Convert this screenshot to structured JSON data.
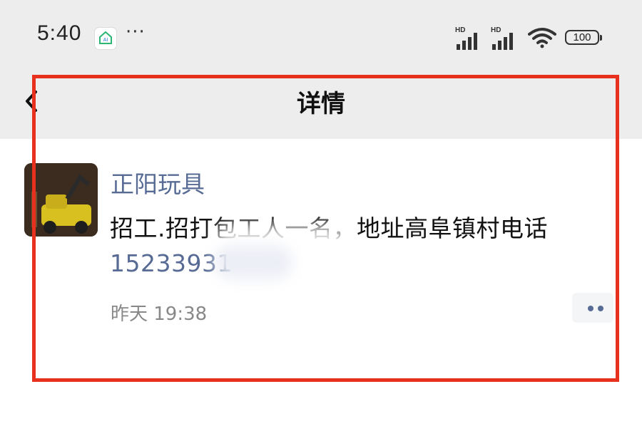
{
  "status_bar": {
    "time": "5:40",
    "overflow": "···",
    "signal_1_label": "HD",
    "signal_2_label": "HD",
    "battery": "100"
  },
  "nav": {
    "title": "详情",
    "back_icon": "chevron-left-icon"
  },
  "moment": {
    "sender": "正阳玩具",
    "text": "招工.招打包工人一名，地址高阜镇村电话",
    "phone": "15233931",
    "timestamp": "昨天 19:38",
    "more_icon": "more-dots-icon"
  },
  "colors": {
    "link": "#576b95",
    "header_bg": "#ededed",
    "highlight": "#e8301e"
  }
}
